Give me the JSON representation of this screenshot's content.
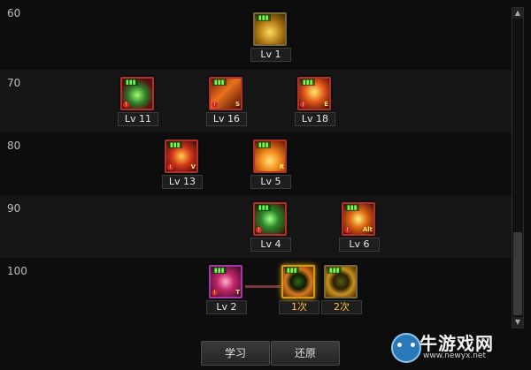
{
  "levels": [
    "60",
    "70",
    "80",
    "90",
    "100"
  ],
  "skills": {
    "s60_1": {
      "level": "Lv 1"
    },
    "s70_1": {
      "level": "Lv 11"
    },
    "s70_2": {
      "level": "Lv 16",
      "hotkey": "S"
    },
    "s70_3": {
      "level": "Lv 18",
      "hotkey": "E"
    },
    "s80_1": {
      "level": "Lv 13",
      "hotkey": "V"
    },
    "s80_2": {
      "level": "Lv 5",
      "hotkey": "R"
    },
    "s90_1": {
      "level": "Lv 4"
    },
    "s90_2": {
      "level": "Lv 6",
      "hotkey": "Alt"
    },
    "s100_1": {
      "level": "Lv 2",
      "hotkey": "T"
    },
    "s100_2": {
      "level": "1次"
    },
    "s100_3": {
      "level": "2次"
    }
  },
  "buttons": {
    "learn": "学习",
    "reset": "还原"
  },
  "watermark": {
    "title": "牛游戏网",
    "url": "www.newyx.net"
  },
  "colors": {
    "gold_border": "#d59b1a",
    "red_border": "#b0302a",
    "purple_border": "#a23aa6",
    "lv_orange": "#ffbf3f"
  }
}
